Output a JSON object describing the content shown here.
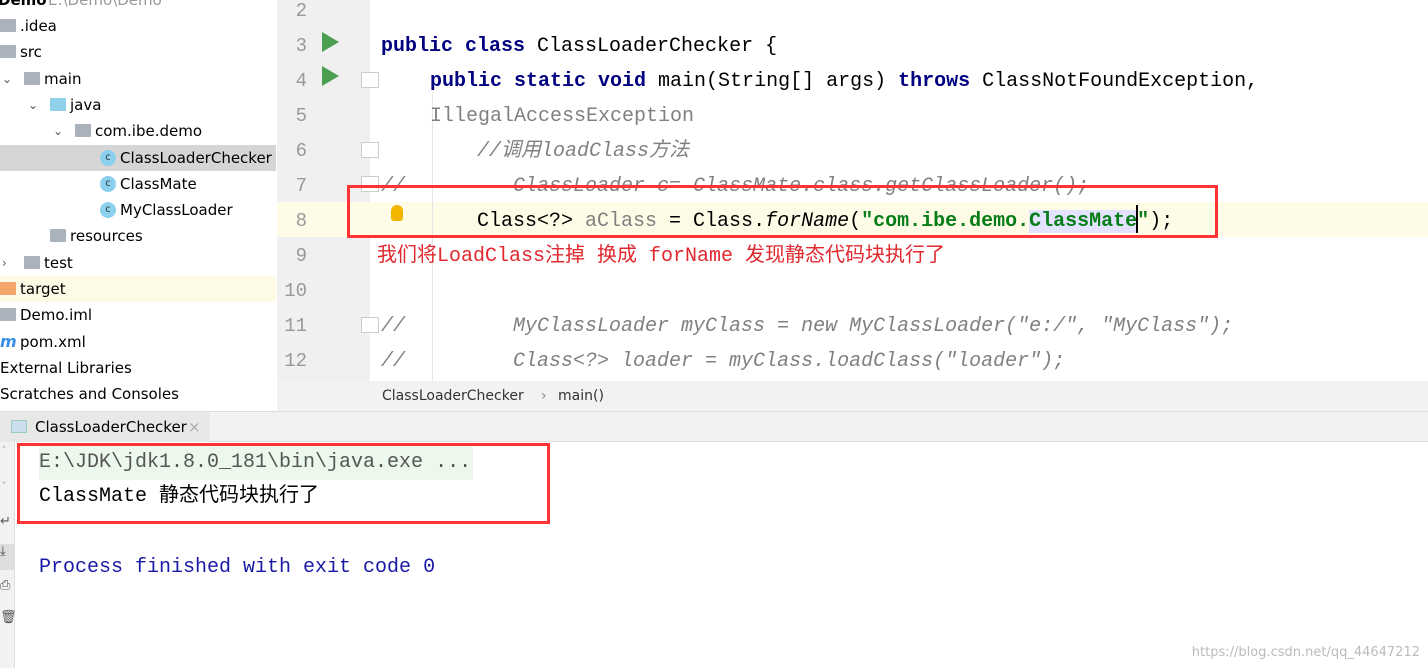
{
  "project": {
    "root": {
      "name": "Demo",
      "path": "E:\\Demo\\Demo"
    },
    "items": [
      {
        "label": ".idea",
        "icon": "folder-icon"
      },
      {
        "label": "src",
        "icon": "folder-icon"
      },
      {
        "label": "main",
        "icon": "folder-icon"
      },
      {
        "label": "java",
        "icon": "source-folder-icon"
      },
      {
        "label": "com.ibe.demo",
        "icon": "package-icon"
      },
      {
        "label": "ClassLoaderChecker",
        "icon": "class-icon"
      },
      {
        "label": "ClassMate",
        "icon": "class-icon"
      },
      {
        "label": "MyClassLoader",
        "icon": "class-icon"
      },
      {
        "label": "resources",
        "icon": "resources-folder-icon"
      },
      {
        "label": "test",
        "icon": "folder-icon"
      },
      {
        "label": "target",
        "icon": "excluded-folder-icon"
      },
      {
        "label": "Demo.iml",
        "icon": "module-file-icon"
      },
      {
        "label": "pom.xml",
        "icon": "maven-icon"
      },
      {
        "label": "External Libraries",
        "icon": "library-icon"
      },
      {
        "label": "Scratches and Consoles",
        "icon": "scratches-icon"
      }
    ],
    "class_letter": "c"
  },
  "editor": {
    "line_numbers": [
      "2",
      "3",
      "4",
      "5",
      "6",
      "7",
      "8",
      "9",
      "10",
      "11",
      "12"
    ],
    "lines": [
      [],
      [
        {
          "t": "public class ",
          "k": "kw"
        },
        {
          "t": "ClassLoaderChecker {",
          "k": ""
        }
      ],
      [
        {
          "t": "public static void ",
          "k": "kw"
        },
        {
          "t": "main(String[] args) ",
          "k": ""
        },
        {
          "t": "throws ",
          "k": "kw"
        },
        {
          "t": "ClassNotFoundException, ",
          "k": ""
        },
        {
          "t": "IllegalAccessException",
          "k": "gray"
        }
      ],
      [],
      [
        {
          "t": "//调用loadClass方法",
          "k": "cm"
        }
      ],
      [
        {
          "t": "//         ClassLoader c= ClassMate.class.getClassLoader();",
          "k": "cm"
        }
      ],
      [
        {
          "t": "Class<?> ",
          "k": ""
        },
        {
          "t": "aClass",
          "k": "gray"
        },
        {
          "t": " = Class.",
          "k": ""
        },
        {
          "t": "forName",
          "k": "ital"
        },
        {
          "t": "(",
          "k": ""
        },
        {
          "t": "\"com.ibe.demo.",
          "k": "str"
        },
        {
          "t": "ClassMate",
          "k": "str sel-bg"
        },
        {
          "t": "\"",
          "k": "str"
        },
        {
          "t": ");",
          "k": ""
        }
      ],
      [
        {
          "t": "我们将LoadClass注掉 换成 forName 发现静态代码块执行了",
          "k": "note"
        }
      ],
      [],
      [
        {
          "t": "//         MyClassLoader myClass = new MyClassLoader(\"e:/\", \"MyClass\");",
          "k": "cm"
        }
      ],
      [
        {
          "t": "//         Class<?> loader = myClass.loadClass(\"loader\");",
          "k": "cm"
        }
      ]
    ],
    "breadcrumb": [
      "ClassLoaderChecker",
      "main()"
    ]
  },
  "run": {
    "tab_label": "ClassLoaderChecker",
    "output": [
      "E:\\JDK\\jdk1.8.0_181\\bin\\java.exe ...",
      "ClassMate 静态代码块执行了",
      "Process finished with exit code 0"
    ]
  },
  "watermark": "https://blog.csdn.net/qq_44647212",
  "colors": {
    "annotation_box": "#ff3333",
    "keyword": "#000080",
    "string": "#067d17",
    "exit_text": "#1a1aa6"
  }
}
